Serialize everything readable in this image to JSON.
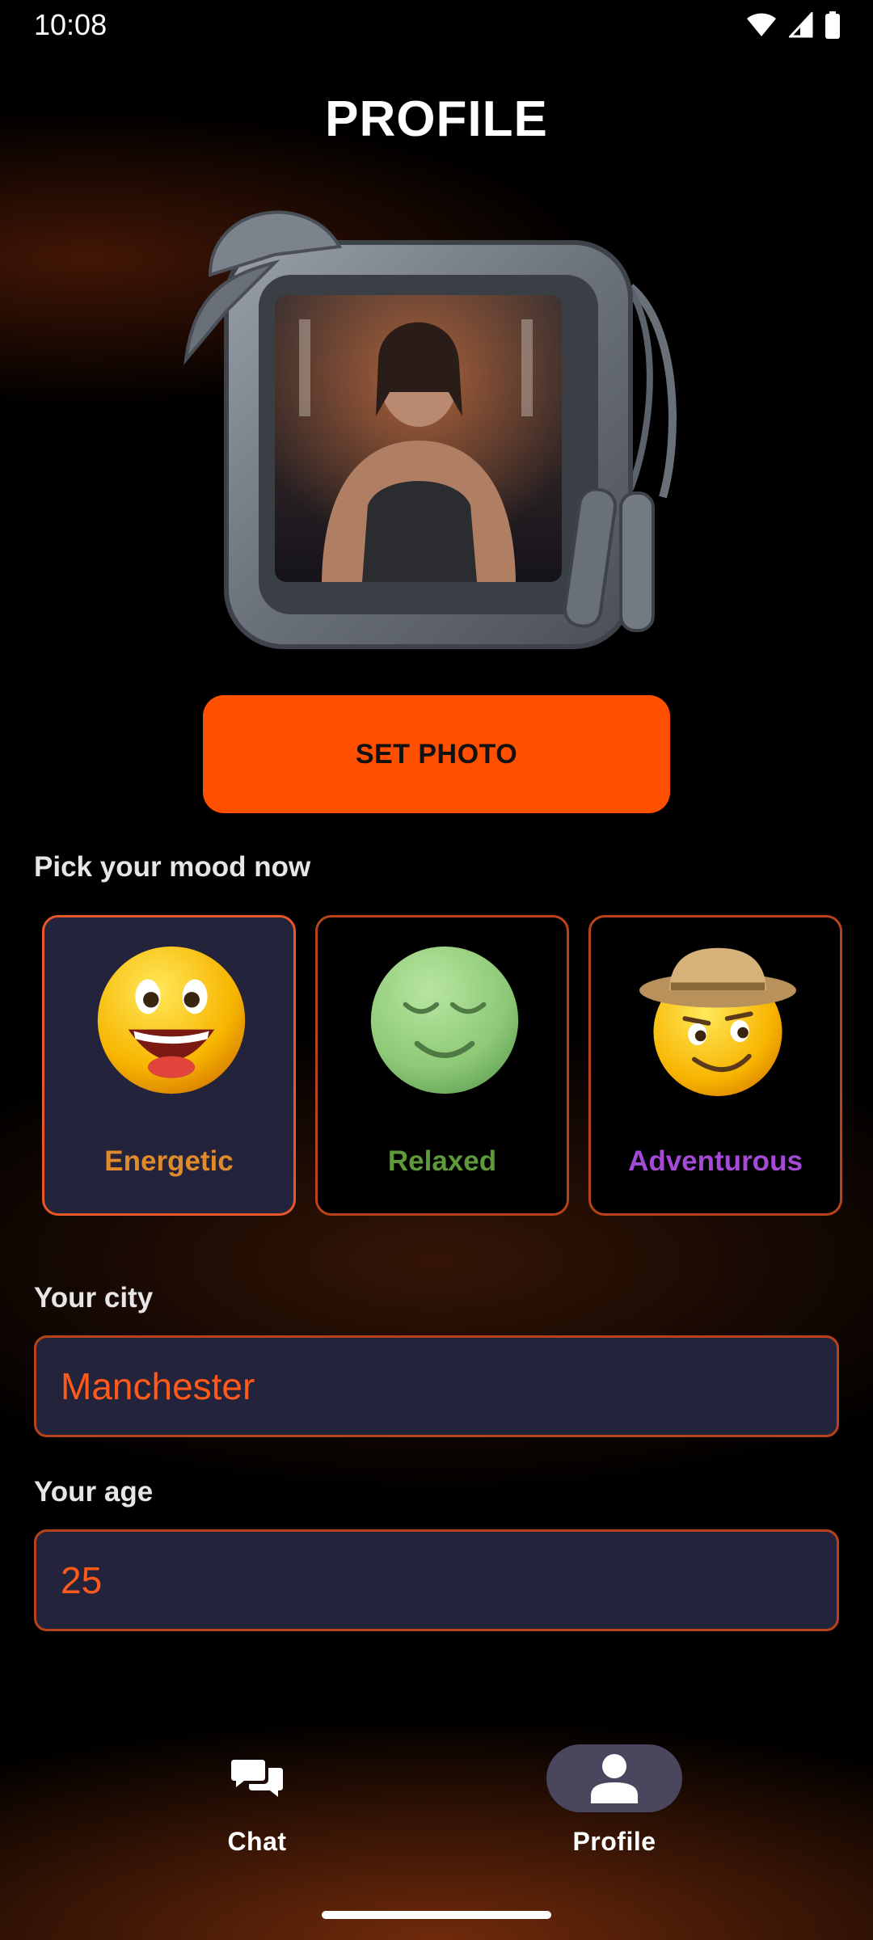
{
  "status_bar": {
    "time": "10:08",
    "icons": [
      "wifi-icon",
      "cellular-signal-icon",
      "battery-icon"
    ]
  },
  "header": {
    "title": "PROFILE"
  },
  "photo": {
    "button_label": "SET PHOTO"
  },
  "mood": {
    "label": "Pick your mood now",
    "options": [
      {
        "label": "Energetic",
        "emoji": "grinning-face",
        "color": "#e08a2a",
        "selected": true
      },
      {
        "label": "Relaxed",
        "emoji": "relieved-face",
        "color": "#5f9a3a",
        "selected": false
      },
      {
        "label": "Adventurous",
        "emoji": "explorer-face",
        "color": "#a44ad6",
        "selected": false
      }
    ]
  },
  "city": {
    "label": "Your city",
    "value": "Manchester"
  },
  "age": {
    "label": "Your age",
    "value": "25"
  },
  "nav": {
    "items": [
      {
        "label": "Chat",
        "icon": "chat-bubbles-icon",
        "active": false
      },
      {
        "label": "Profile",
        "icon": "person-icon",
        "active": true
      }
    ]
  },
  "colors": {
    "accent": "#ff4f00",
    "card_bg": "#23233c",
    "border": "#b8431a",
    "input_text": "#ff5a1a"
  }
}
